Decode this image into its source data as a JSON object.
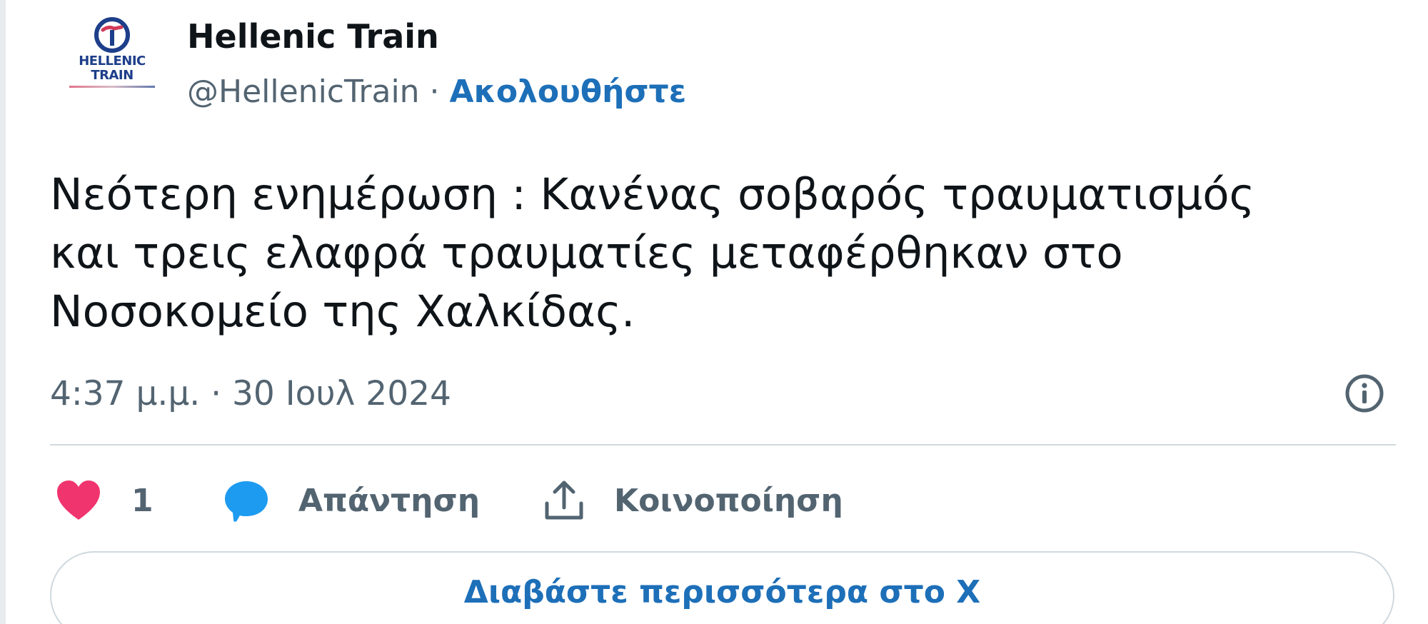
{
  "author": {
    "display_name": "Hellenic Train",
    "handle": "@HellenicTrain",
    "separator": " · ",
    "follow_label": "Ακολουθήστε",
    "avatar_text_line1": "HELLENIC",
    "avatar_text_line2": "TRAIN",
    "avatar_icon": "hellenic-train-logo"
  },
  "tweet": {
    "text": "Νεότερη ενημέρωση : Κανένας σοβαρός τραυματισμός\nκαι τρεις ελαφρά τραυματίες μεταφέρθηκαν στο\nΝοσοκομείο της Χαλκίδας.",
    "timestamp": "4:37 μ.μ. · 30 Ιουλ 2024"
  },
  "actions": {
    "like_count": "1",
    "reply_label": "Απάντηση",
    "share_label": "Κοινοποίηση"
  },
  "read_more_label": "Διαβάστε περισσότερα στο X",
  "colors": {
    "text": "#0f1419",
    "secondary": "#536471",
    "link": "#1d6fb8",
    "like": "#f0346e",
    "reply": "#1d9bf0",
    "border": "#cfd9de"
  },
  "icons": {
    "like": "heart-icon",
    "reply": "speech-bubble-icon",
    "share": "share-upload-icon",
    "info": "info-icon"
  }
}
